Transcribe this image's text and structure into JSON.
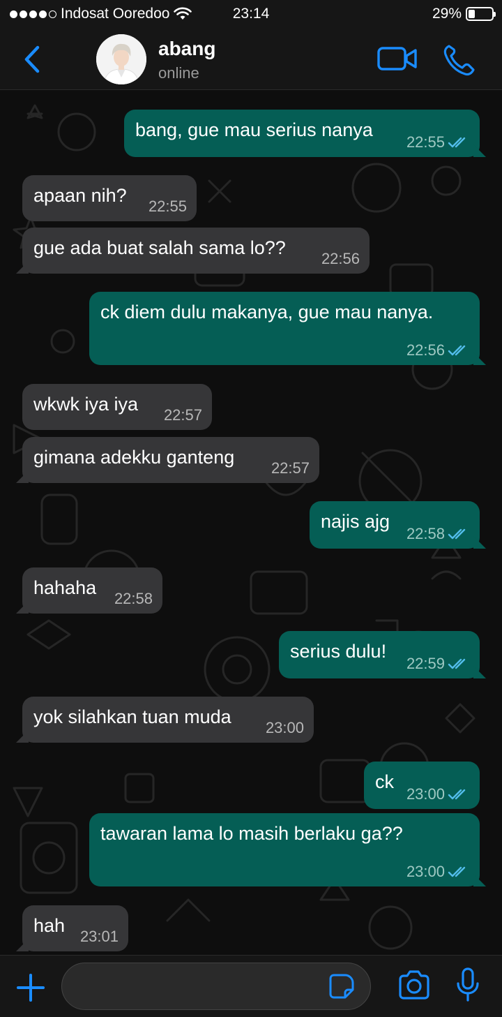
{
  "status_bar": {
    "carrier": "Indosat Ooredoo",
    "time": "23:14",
    "battery": "29%",
    "battery_level": 0.29,
    "signal_bars": 4
  },
  "header": {
    "contact_name": "abang",
    "presence": "online",
    "icons": [
      "back-chevron-icon",
      "avatar",
      "video-call-icon",
      "phone-call-icon"
    ]
  },
  "messages": [
    {
      "dir": "out",
      "text": "bang, gue mau serius nanya",
      "time": "22:55",
      "read": true
    },
    {
      "dir": "in",
      "text": "apaan nih?",
      "time": "22:55"
    },
    {
      "dir": "in",
      "text": "gue ada buat salah sama lo??",
      "time": "22:56"
    },
    {
      "dir": "out",
      "text": "ck diem dulu makanya, gue mau nanya.",
      "time": "22:56",
      "read": true
    },
    {
      "dir": "in",
      "text": "wkwk iya iya",
      "time": "22:57"
    },
    {
      "dir": "in",
      "text": "gimana adekku ganteng",
      "time": "22:57"
    },
    {
      "dir": "out",
      "text": "najis ajg",
      "time": "22:58",
      "read": true
    },
    {
      "dir": "in",
      "text": "hahaha",
      "time": "22:58"
    },
    {
      "dir": "out",
      "text": "serius dulu!",
      "time": "22:59",
      "read": true
    },
    {
      "dir": "in",
      "text": "yok silahkan tuan muda",
      "time": "23:00"
    },
    {
      "dir": "out",
      "text": "ck",
      "time": "23:00",
      "read": true
    },
    {
      "dir": "out",
      "text": "tawaran lama lo masih berlaku ga??",
      "time": "23:00",
      "read": true
    },
    {
      "dir": "in",
      "text": "hah",
      "time": "23:01"
    }
  ],
  "composer": {
    "placeholder": "",
    "icons": [
      "plus-icon",
      "sticker-icon",
      "camera-icon",
      "microphone-icon"
    ]
  },
  "colors": {
    "accent": "#1a8cff",
    "outgoing_bubble": "#055e55",
    "incoming_bubble": "#363638",
    "read_tick": "#53bdeb"
  }
}
